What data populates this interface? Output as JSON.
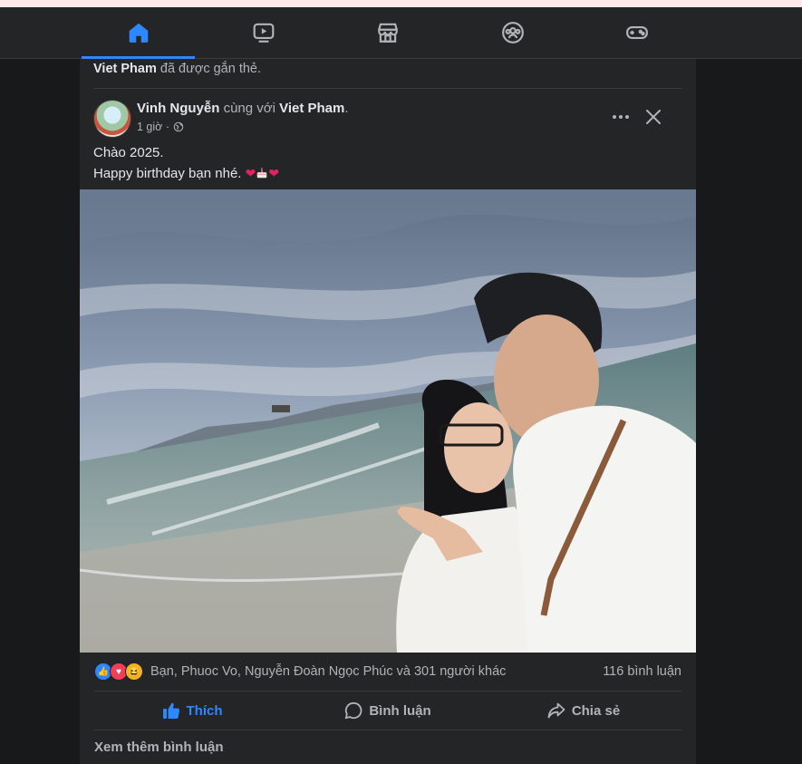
{
  "nav": {
    "tabs": [
      {
        "name": "home",
        "icon": "home-icon",
        "active": true
      },
      {
        "name": "watch",
        "icon": "video-icon",
        "active": false
      },
      {
        "name": "marketplace",
        "icon": "store-icon",
        "active": false
      },
      {
        "name": "groups",
        "icon": "groups-icon",
        "active": false
      },
      {
        "name": "gaming",
        "icon": "gamepad-icon",
        "active": false
      }
    ]
  },
  "tagged": {
    "name": "Viet Pham",
    "suffix": " đã được gắn thẻ."
  },
  "post": {
    "author": "Vinh Nguyễn",
    "with_text": " cùng với ",
    "tagged_name": "Viet Pham",
    "period": ".",
    "time": "1 giờ ·",
    "line1": "Chào 2025.",
    "line2": "Happy birthday bạn nhé. ",
    "reactions_text": "Bạn, Phuoc Vo, Nguyễn Đoàn Ngọc Phúc và 301 người khác",
    "comments_count": "116 bình luận",
    "more_comments": "Xem thêm bình luận"
  },
  "actions": {
    "like": "Thích",
    "comment": "Bình luận",
    "share": "Chia sẻ"
  },
  "colors": {
    "accent": "#2d88ff",
    "surface": "#242526",
    "background": "#18191a",
    "text_secondary": "#b0b3b8"
  }
}
